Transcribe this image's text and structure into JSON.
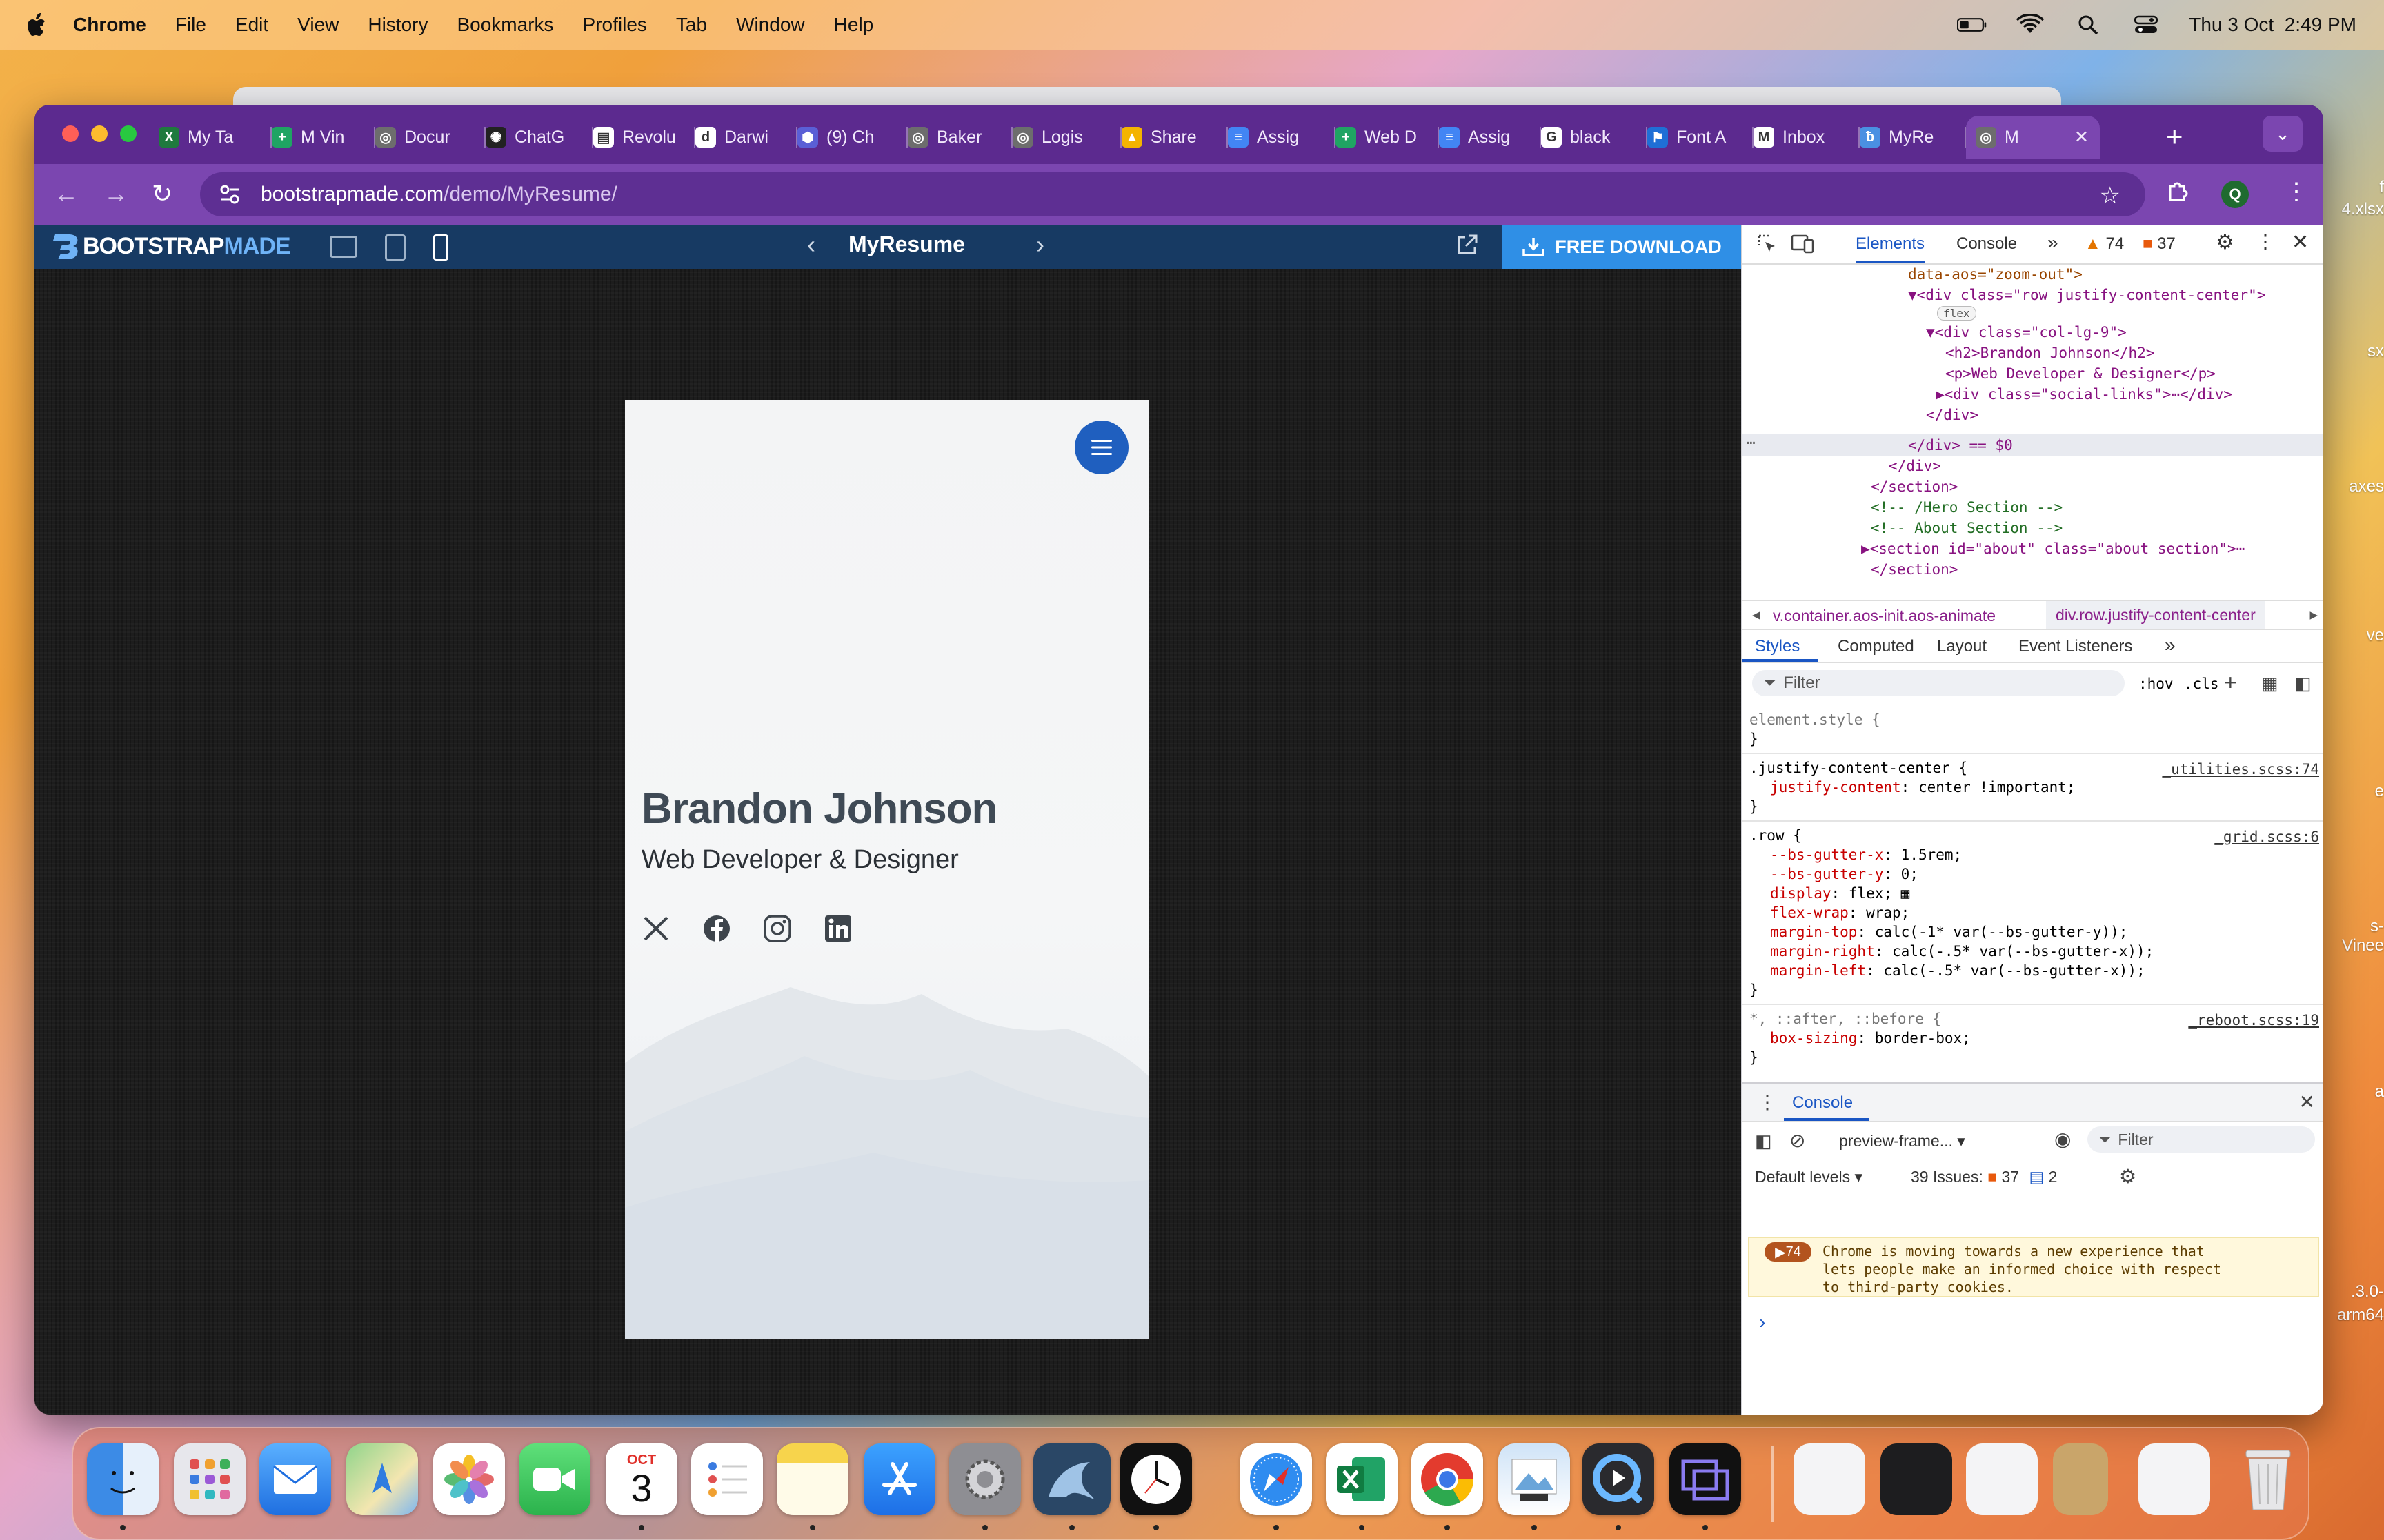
{
  "menubar": {
    "app": "Chrome",
    "items": [
      "File",
      "Edit",
      "View",
      "History",
      "Bookmarks",
      "Profiles",
      "Tab",
      "Window",
      "Help"
    ],
    "datetime": "Thu 3 Oct  2:49 PM"
  },
  "desktop_labels": [
    "f",
    "4.xlsx",
    "sx",
    "axes",
    "ve",
    "e",
    "s-Vinee",
    "a",
    ".3.0-",
    "arm64"
  ],
  "tabs": [
    {
      "label": "My Ta",
      "fav": "X",
      "color": "#1f7a3e"
    },
    {
      "label": "M Vin",
      "fav": "+",
      "color": "#1fa463"
    },
    {
      "label": "Docur",
      "fav": "◎",
      "color": "#6d6d6d"
    },
    {
      "label": "ChatG",
      "fav": "✺",
      "color": "#222222"
    },
    {
      "label": "Revolu",
      "fav": "▤",
      "color": "#ffffff"
    },
    {
      "label": "Darwi",
      "fav": "d",
      "color": "#ffffff"
    },
    {
      "label": "(9) Ch",
      "fav": "⬢",
      "color": "#5a5fd6"
    },
    {
      "label": "Baker",
      "fav": "◎",
      "color": "#6d6d6d"
    },
    {
      "label": "Logis",
      "fav": "◎",
      "color": "#6d6d6d"
    },
    {
      "label": "Share",
      "fav": "▲",
      "color": "#f4b400"
    },
    {
      "label": "Assig",
      "fav": "≡",
      "color": "#4285f4"
    },
    {
      "label": "Web D",
      "fav": "+",
      "color": "#1fa463"
    },
    {
      "label": "Assig",
      "fav": "≡",
      "color": "#4285f4"
    },
    {
      "label": "black",
      "fav": "G",
      "color": "#ffffff"
    },
    {
      "label": "Font A",
      "fav": "⚑",
      "color": "#1f6fd6"
    },
    {
      "label": "Inbox",
      "fav": "M",
      "color": "#ffffff"
    },
    {
      "label": "MyRe",
      "fav": "ƀ",
      "color": "#4a90e2"
    },
    {
      "label": "M",
      "fav": "◎",
      "color": "#6d6d6d"
    }
  ],
  "address": {
    "domain": "bootstrapmade.com",
    "path": "/demo/MyResume/"
  },
  "profile_initial": "Q",
  "bootstrapmade": {
    "logo_a": "BOOTSTRAP",
    "logo_b": "MADE",
    "title": "MyResume",
    "download": "FREE DOWNLOAD"
  },
  "hero": {
    "name": "Brandon Johnson",
    "subtitle": "Web Developer & Designer",
    "social": [
      "X",
      "f",
      "◎",
      "in"
    ]
  },
  "devtools": {
    "tabs": [
      "Elements",
      "Console"
    ],
    "warn_count": "74",
    "err_count": "37",
    "code_lines": [
      {
        "indent": 12,
        "html": "data-aos=\"zoom-out\">"
      },
      {
        "indent": 12,
        "html": "▼<div class=\"row justify-content-center\">"
      },
      {
        "indent": 14,
        "html": "flex"
      },
      {
        "indent": 13,
        "html": "▼<div class=\"col-lg-9\">"
      },
      {
        "indent": 15,
        "html": "<h2>Brandon Johnson</h2>"
      },
      {
        "indent": 15,
        "html": "<p>Web Developer & Designer</p>"
      },
      {
        "indent": 14,
        "html": "▶<div class=\"social-links\">⋯</div>"
      },
      {
        "indent": 13,
        "html": "</div>"
      },
      {
        "indent": 12,
        "html": "</div> == $0"
      },
      {
        "indent": 11,
        "html": "</div>"
      },
      {
        "indent": 10,
        "html": "</section>"
      },
      {
        "indent": 10,
        "html": "<!-- /Hero Section -->"
      },
      {
        "indent": 10,
        "html": "<!-- About Section -->"
      },
      {
        "indent": 9,
        "html": "▶<section id=\"about\" class=\"about section\">⋯"
      },
      {
        "indent": 10,
        "html": "</section>"
      }
    ],
    "breadcrumbs": [
      "v.container.aos-init.aos-animate",
      "div.row.justify-content-center"
    ],
    "style_tabs": [
      "Styles",
      "Computed",
      "Layout",
      "Event Listeners"
    ],
    "filter_placeholder": "Filter",
    "hov": ":hov",
    "cls": ".cls",
    "rules": [
      {
        "selector": "element.style {",
        "source": "",
        "decls": [],
        "close": "}"
      },
      {
        "selector": ".justify-content-center {",
        "source": "_utilities.scss:74",
        "decls": [
          [
            "justify-content",
            "center !important;"
          ]
        ],
        "close": "}"
      },
      {
        "selector": ".row {",
        "source": "_grid.scss:6",
        "decls": [
          [
            "--bs-gutter-x",
            "1.5rem;"
          ],
          [
            "--bs-gutter-y",
            "0;"
          ],
          [
            "display",
            "flex; ▦"
          ],
          [
            "flex-wrap",
            "wrap;"
          ],
          [
            "margin-top",
            "calc(-1* var(--bs-gutter-y));"
          ],
          [
            "margin-right",
            "calc(-.5* var(--bs-gutter-x));"
          ],
          [
            "margin-left",
            "calc(-.5* var(--bs-gutter-x));"
          ]
        ],
        "close": "}"
      },
      {
        "selector": "*, ::after, ::before {",
        "source": "_reboot.scss:19",
        "decls": [
          [
            "box-sizing",
            "border-box;"
          ]
        ],
        "close": "}"
      }
    ],
    "console": {
      "title": "Console",
      "context": "preview-frame...",
      "filter": "Filter",
      "levels": "Default levels",
      "issues": "39 Issues:",
      "issue_err": "37",
      "issue_info": "2",
      "msg_count": "74",
      "message": [
        "Chrome is moving towards a new experience that",
        "lets people make an informed choice with respect",
        "to third-party cookies."
      ]
    }
  },
  "dock": {
    "calendar_month": "OCT",
    "calendar_day": "3",
    "apps": [
      "finder",
      "launchpad",
      "mail",
      "maps",
      "photos",
      "facetime",
      "calendar",
      "reminders",
      "notes",
      "app-store",
      "system-settings",
      "mysql-workbench",
      "clock",
      "safari",
      "excel",
      "chrome",
      "preview",
      "quicktime",
      "screen-app"
    ]
  }
}
